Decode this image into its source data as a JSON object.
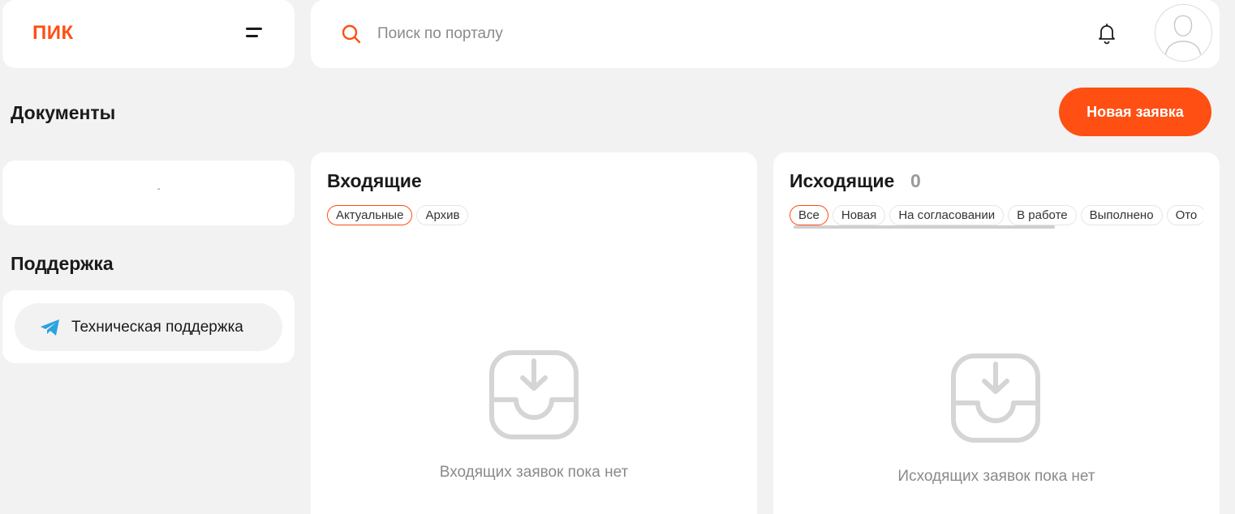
{
  "logo": {
    "text": "ПИК"
  },
  "header": {
    "search_placeholder": "Поиск по порталу"
  },
  "page": {
    "title": "Документы",
    "new_request_label": "Новая заявка"
  },
  "documents": {
    "placeholder": "-"
  },
  "support": {
    "title": "Поддержка",
    "button_label": "Техническая поддержка"
  },
  "incoming": {
    "title": "Входящие",
    "tabs": [
      "Актуальные",
      "Архив"
    ],
    "active_tab": "Актуальные",
    "empty_text": "Входящих заявок пока нет"
  },
  "outgoing": {
    "title": "Исходящие",
    "count": "0",
    "tabs": [
      "Все",
      "Новая",
      "На согласовании",
      "В работе",
      "Выполнено",
      "Ото"
    ],
    "active_tab": "Все",
    "empty_text": "Исходящих заявок пока нет"
  },
  "colors": {
    "accent": "#ff4f12",
    "background": "#f2f2f2",
    "muted_text": "#8a8a8a",
    "telegram": "#2aa3df"
  },
  "icons": [
    "menu-icon",
    "search-icon",
    "bell-icon",
    "user-avatar-icon",
    "telegram-icon",
    "inbox-download-icon"
  ]
}
